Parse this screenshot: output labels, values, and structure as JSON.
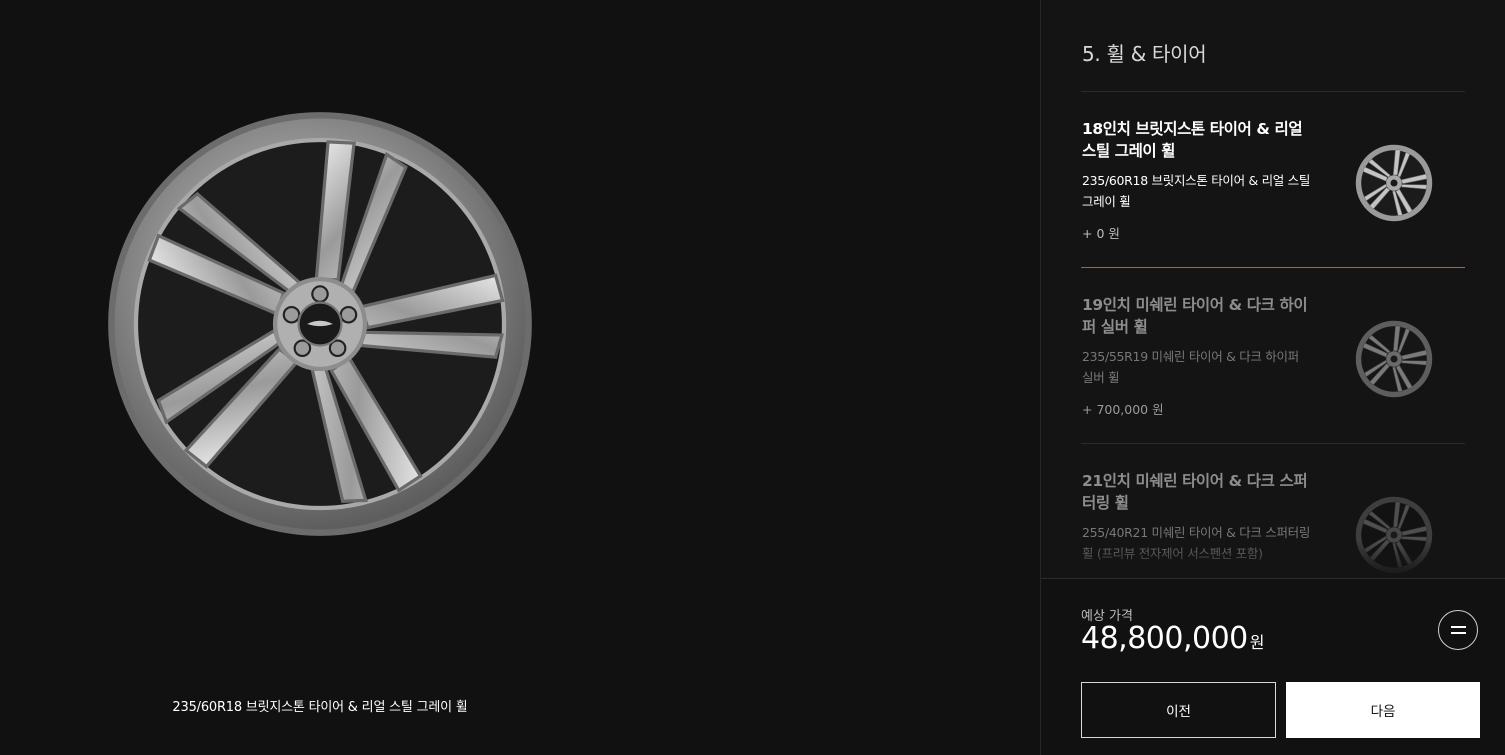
{
  "preview": {
    "caption": "235/60R18 브릿지스톤 타이어 & 리얼 스틸 그레이 휠",
    "wheel_icon": "wheel-18-inch-silver"
  },
  "panel": {
    "step_title": "5. 휠 & 타이어",
    "options": [
      {
        "title": "18인치 브릿지스톤 타이어 & 리얼 스틸 그레이 휠",
        "spec": "235/60R18 브릿지스톤 타이어 & 리얼 스틸 그레이 휠",
        "price": "+ 0 원",
        "selected": true,
        "thumb_icon": "wheel-silver-icon"
      },
      {
        "title": "19인치 미쉐린 타이어 & 다크 하이퍼 실버 휠",
        "spec": "235/55R19 미쉐린 타이어 & 다크 하이퍼 실버 휠",
        "price": "+ 700,000 원",
        "selected": false,
        "thumb_icon": "wheel-dark-hyper-silver-icon"
      },
      {
        "title": "21인치 미쉐린 타이어 & 다크 스퍼터링 휠",
        "spec": "255/40R21 미쉐린 타이어 & 다크 스퍼터링 휠 (프리뷰 전자제어 서스펜션 포함)",
        "price": "",
        "selected": false,
        "thumb_icon": "wheel-dark-sputtering-icon"
      }
    ]
  },
  "summary": {
    "price_label": "예상 가격",
    "price_value": "48,800,000",
    "price_unit": "원",
    "menu_icon": "equals-icon"
  },
  "nav": {
    "prev_label": "이전",
    "next_label": "다음"
  },
  "colors": {
    "background": "#111111",
    "panel": "#141414",
    "selected_divider": "#8a6d5d",
    "next_button_bg": "#ffffff"
  }
}
